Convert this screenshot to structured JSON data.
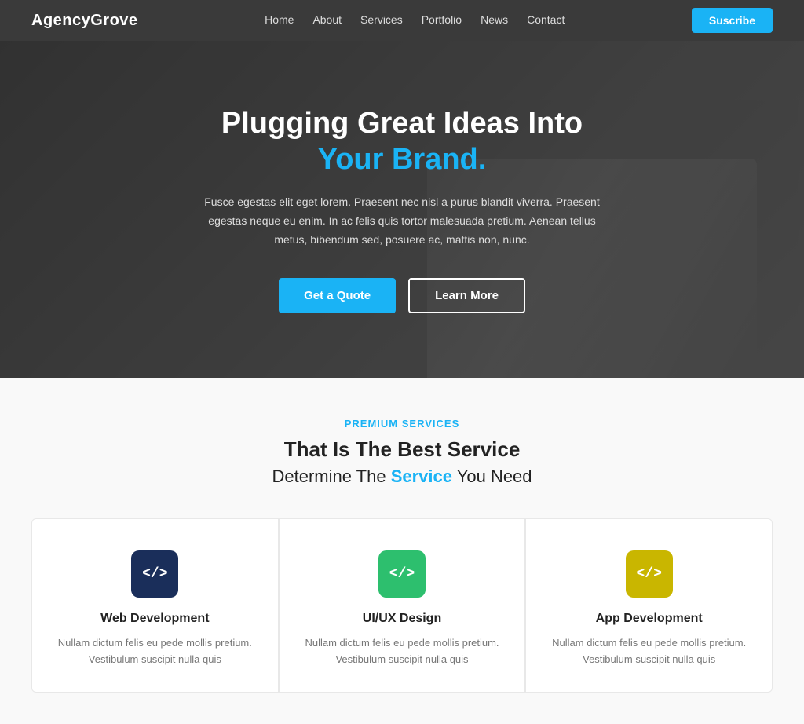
{
  "nav": {
    "logo": "AgencyGrove",
    "links": [
      {
        "label": "Home",
        "href": "#"
      },
      {
        "label": "About",
        "href": "#"
      },
      {
        "label": "Services",
        "href": "#"
      },
      {
        "label": "Portfolio",
        "href": "#"
      },
      {
        "label": "News",
        "href": "#"
      },
      {
        "label": "Contact",
        "href": "#"
      }
    ],
    "subscribe_label": "Suscribe"
  },
  "hero": {
    "title_part1": "Plugging Great Ideas Into ",
    "title_highlight": "Your Brand.",
    "subtitle": "Fusce egestas elit eget lorem. Praesent nec nisl a purus blandit viverra. Praesent egestas neque eu enim. In ac felis quis tortor malesuada pretium. Aenean tellus metus, bibendum sed, posuere ac, mattis non, nunc.",
    "cta_primary": "Get a Quote",
    "cta_secondary": "Learn More"
  },
  "services": {
    "label": "Premium Services",
    "title": "That Is The Best Service",
    "subtitle_part1": "Determine The ",
    "subtitle_highlight": "Service",
    "subtitle_part2": " You Need",
    "cards": [
      {
        "icon_label": "</>",
        "icon_color": "dark-blue",
        "name": "Web Development",
        "desc": "Nullam dictum felis eu pede mollis pretium. Vestibulum suscipit nulla quis"
      },
      {
        "icon_label": "</>",
        "icon_color": "green",
        "name": "UI/UX Design",
        "desc": "Nullam dictum felis eu pede mollis pretium. Vestibulum suscipit nulla quis"
      },
      {
        "icon_label": "</>",
        "icon_color": "yellow",
        "name": "App Development",
        "desc": "Nullam dictum felis eu pede mollis pretium. Vestibulum suscipit nulla quis"
      }
    ]
  }
}
